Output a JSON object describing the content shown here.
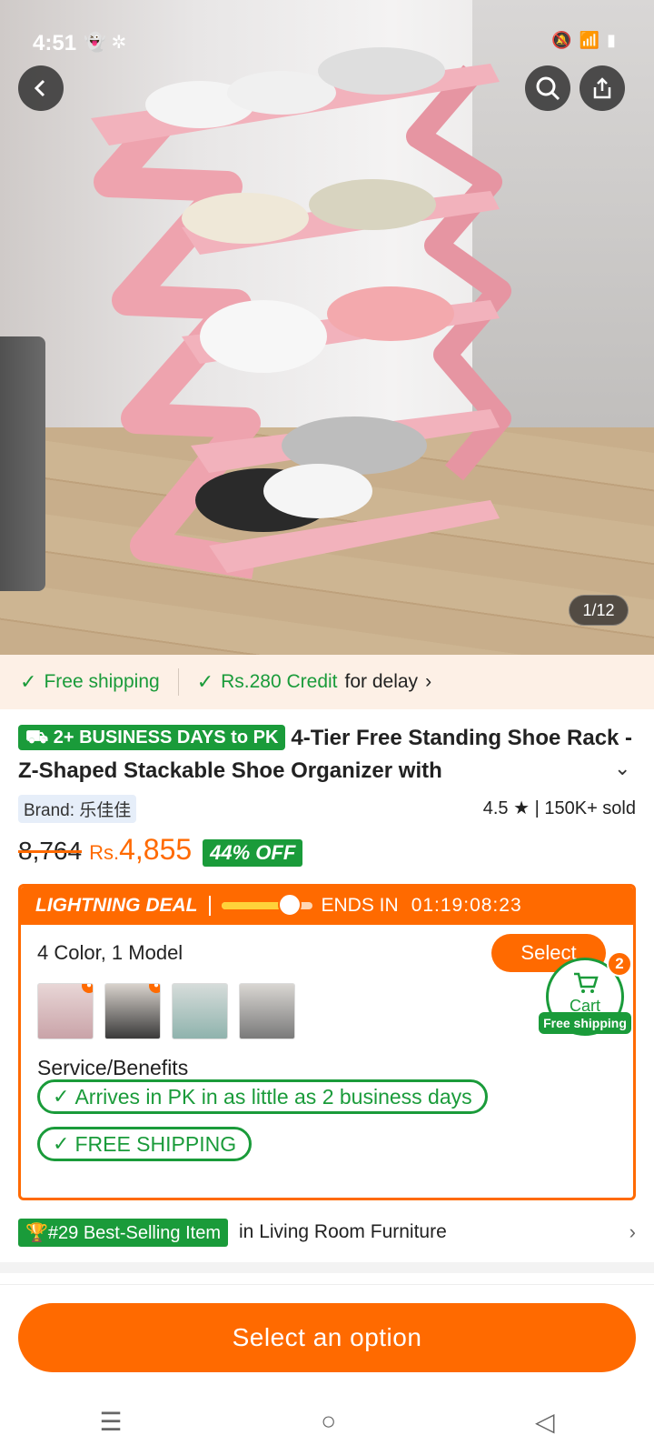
{
  "status_bar": {
    "time": "4:51"
  },
  "hero": {
    "pager": "1/12"
  },
  "shipping_banner": {
    "free_shipping": "Free shipping",
    "credit": "Rs.280 Credit",
    "credit_suffix": "for delay"
  },
  "product": {
    "delivery_tag": "2+ BUSINESS DAYS to PK",
    "title": "4-Tier Free Standing Shoe Rack - Z-Shaped Stackable Shoe Organizer with",
    "brand": "Brand: 乐佳佳",
    "rating": "4.5",
    "sold": "150K+ sold",
    "old_price": "8,764",
    "currency": "Rs.",
    "price": "4,855",
    "discount": "44% OFF"
  },
  "deal": {
    "label": "LIGHTNING DEAL",
    "progress": 0.75,
    "ends_label": "ENDS IN",
    "timer": "01:19:08:23",
    "variants": "4 Color, 1 Model",
    "select_label": "Select",
    "benefits_label": "Service/Benefits",
    "benefit_1": "Arrives in PK in as little as 2 business days",
    "benefit_2": "FREE SHIPPING"
  },
  "cart": {
    "label": "Cart",
    "count": "2",
    "free_shipping": "Free shipping"
  },
  "best_seller": {
    "tag": "#29 Best-Selling Item",
    "suffix": "in Living Room Furniture"
  },
  "cta": {
    "label": "Select an option"
  },
  "colors": {
    "accent": "#ff6a00",
    "green": "#1a9b3a",
    "rack_pink": "#eea3ae"
  }
}
